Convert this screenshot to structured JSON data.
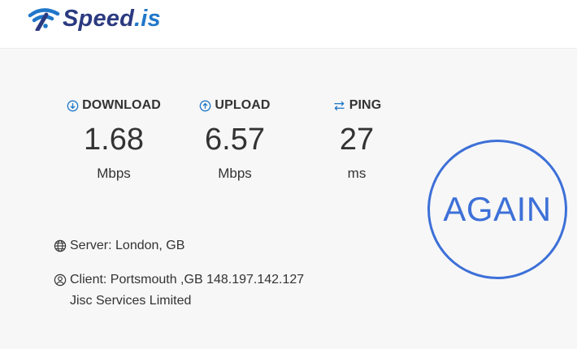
{
  "brand": {
    "name_part1": "Speed",
    "name_part2": ".is",
    "color_dark": "#2b3a80",
    "color_accent": "#1f77c9"
  },
  "metrics": [
    {
      "name": "DOWNLOAD",
      "icon": "download-circle-icon",
      "value": "1.68",
      "unit": "Mbps"
    },
    {
      "name": "UPLOAD",
      "icon": "upload-circle-icon",
      "value": "6.57",
      "unit": "Mbps"
    },
    {
      "name": "PING",
      "icon": "swap-arrows-icon",
      "value": "27",
      "unit": "ms"
    }
  ],
  "server": {
    "icon": "globe-icon",
    "text": "Server: London, GB"
  },
  "client": {
    "icon": "user-circle-icon",
    "line1": "Client: Portsmouth ,GB 148.197.142.127",
    "line2": "Jisc Services Limited"
  },
  "again_button": {
    "label": "AGAIN",
    "color": "#3d70d8"
  },
  "icon_color": "#1f77c9"
}
